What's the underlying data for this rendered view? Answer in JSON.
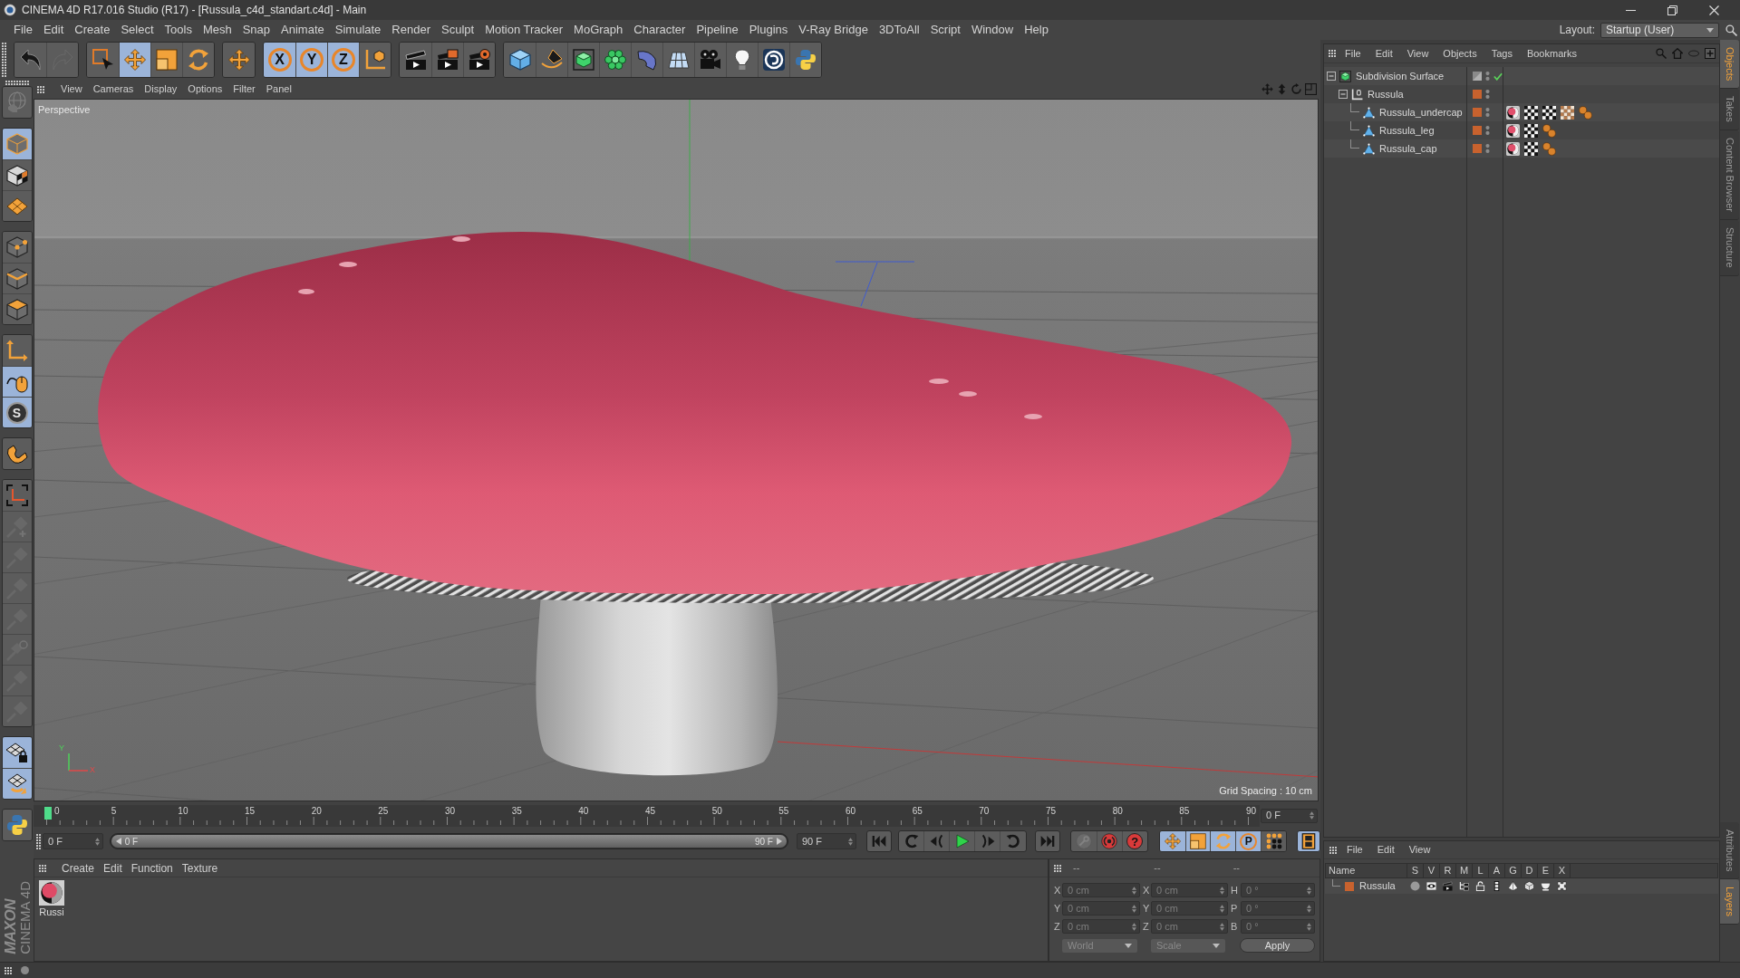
{
  "window": {
    "title": "CINEMA 4D R17.016 Studio (R17) - [Russula_c4d_standart.c4d] - Main"
  },
  "menu": [
    "File",
    "Edit",
    "Create",
    "Select",
    "Tools",
    "Mesh",
    "Snap",
    "Animate",
    "Simulate",
    "Render",
    "Sculpt",
    "Motion Tracker",
    "MoGraph",
    "Character",
    "Pipeline",
    "Plugins",
    "V-Ray Bridge",
    "3DToAll",
    "Script",
    "Window",
    "Help"
  ],
  "layout": {
    "label": "Layout:",
    "value": "Startup (User)"
  },
  "toolbar": {
    "groups": [
      [
        {
          "selected": false,
          "disabled": false
        },
        {
          "selected": false,
          "disabled": true
        }
      ],
      [
        {
          "selected": false,
          "disabled": false
        },
        {
          "selected": true,
          "disabled": false
        },
        {
          "selected": false,
          "disabled": false
        },
        {
          "selected": false,
          "disabled": false
        }
      ],
      [
        {
          "selected": false,
          "disabled": false
        }
      ],
      [
        {
          "label": "X",
          "selected": true,
          "disabled": false
        },
        {
          "label": "Y",
          "selected": true,
          "disabled": false
        },
        {
          "label": "Z",
          "selected": true,
          "disabled": false
        },
        {
          "selected": false,
          "disabled": false
        }
      ],
      [
        {
          "selected": false,
          "disabled": false
        },
        {
          "selected": false,
          "disabled": false
        },
        {
          "selected": false,
          "disabled": false
        }
      ],
      [
        {
          "selected": false,
          "disabled": false
        },
        {
          "selected": false,
          "disabled": false
        },
        {
          "selected": false,
          "disabled": false
        },
        {
          "selected": false,
          "disabled": false
        },
        {
          "selected": false,
          "disabled": false
        },
        {
          "selected": false,
          "disabled": false
        },
        {
          "selected": false,
          "disabled": false
        },
        {
          "selected": false,
          "disabled": false
        },
        {
          "selected": false,
          "disabled": false
        },
        {
          "selected": false,
          "disabled": false
        }
      ]
    ]
  },
  "left_toolbar": {
    "groups": [
      [
        {
          "selected": false,
          "disabled": true
        }
      ],
      [
        {
          "selected": true,
          "disabled": false
        },
        {
          "selected": false,
          "disabled": false
        },
        {
          "selected": false,
          "disabled": false
        }
      ],
      [
        {
          "selected": false,
          "disabled": false
        },
        {
          "selected": false,
          "disabled": false
        },
        {
          "selected": false,
          "disabled": false
        }
      ],
      [
        {
          "selected": false,
          "disabled": false
        },
        {
          "selected": true,
          "disabled": false
        },
        {
          "label": "S",
          "selected": true,
          "disabled": false
        }
      ],
      [
        {
          "selected": false,
          "disabled": false
        }
      ],
      [
        {
          "selected": false,
          "disabled": false
        },
        {
          "selected": false,
          "disabled": true
        },
        {
          "selected": false,
          "disabled": true
        },
        {
          "selected": false,
          "disabled": true
        },
        {
          "selected": false,
          "disabled": true
        },
        {
          "selected": false,
          "disabled": true
        },
        {
          "selected": false,
          "disabled": true
        },
        {
          "selected": false,
          "disabled": true
        }
      ],
      [
        {
          "selected": true,
          "disabled": false
        },
        {
          "selected": true,
          "disabled": false
        }
      ],
      [
        {
          "selected": false,
          "disabled": false
        }
      ]
    ]
  },
  "logo": {
    "brand": "MAXON",
    "product": "CINEMA 4D"
  },
  "viewport": {
    "menu": [
      "View",
      "Cameras",
      "Display",
      "Options",
      "Filter",
      "Panel"
    ],
    "camera": "Perspective",
    "grid_spacing": "Grid Spacing : 10 cm",
    "axis_labels": [
      "Y",
      "X"
    ]
  },
  "timeline": {
    "ticks": [
      "0",
      "5",
      "10",
      "15",
      "20",
      "25",
      "30",
      "35",
      "40",
      "45",
      "50",
      "55",
      "60",
      "65",
      "70",
      "75",
      "80",
      "85",
      "90"
    ],
    "playhead": {
      "level": 0
    },
    "frame_field": "0 F",
    "start_field": "0 F",
    "range": {
      "start": "0 F",
      "end": "90 F",
      "level": 1
    },
    "end_field": "90 F"
  },
  "transport": {
    "record_buttons": [
      {
        "disabled": true
      },
      {
        "disabled": false
      },
      {
        "label": "?",
        "disabled": false
      }
    ],
    "key_modes": [
      {
        "selected": true
      },
      {
        "selected": true
      },
      {
        "selected": true
      },
      {
        "label": "P",
        "selected": true
      },
      {
        "selected": false
      }
    ],
    "timeline_button": {
      "selected": true
    }
  },
  "material_manager": {
    "menu": [
      "Create",
      "Edit",
      "Function",
      "Texture"
    ],
    "materials": [
      {
        "name": "Russi",
        "selected": false
      }
    ]
  },
  "coordinates": {
    "headers": [
      "--",
      "--",
      "--"
    ],
    "disabled": true,
    "rows": [
      [
        {
          "label": "X",
          "value": "0 cm"
        },
        {
          "label": "X",
          "value": "0 cm"
        },
        {
          "label": "H",
          "value": "0 °"
        }
      ],
      [
        {
          "label": "Y",
          "value": "0 cm"
        },
        {
          "label": "Y",
          "value": "0 cm"
        },
        {
          "label": "P",
          "value": "0 °"
        }
      ],
      [
        {
          "label": "Z",
          "value": "0 cm"
        },
        {
          "label": "Z",
          "value": "0 cm"
        },
        {
          "label": "B",
          "value": "0 °"
        }
      ]
    ],
    "mode": "World",
    "transform": "Scale",
    "apply": "Apply"
  },
  "object_manager": {
    "menu": [
      "File",
      "Edit",
      "View",
      "Objects",
      "Tags",
      "Bookmarks"
    ],
    "objects": [
      {
        "name": "Subdivision Surface",
        "kind": "subdivision",
        "expanded": true,
        "enabled": true,
        "selected": false,
        "children": [
          {
            "name": "Russula",
            "kind": "null",
            "expanded": true,
            "selected": false,
            "color": "#c8622e",
            "children": [
              {
                "name": "Russula_undercap",
                "kind": "polygon",
                "selected": false,
                "color": "#c8622e",
                "tags": [
                  {
                    "kind": "material"
                  },
                  {
                    "kind": "uvw"
                  },
                  {
                    "kind": "uvw"
                  },
                  {
                    "kind": "texture"
                  },
                  {
                    "kind": "phong"
                  }
                ]
              },
              {
                "name": "Russula_leg",
                "kind": "polygon",
                "selected": false,
                "color": "#c8622e",
                "tags": [
                  {
                    "kind": "material"
                  },
                  {
                    "kind": "uvw"
                  },
                  {
                    "kind": "phong"
                  }
                ]
              },
              {
                "name": "Russula_cap",
                "kind": "polygon",
                "selected": false,
                "color": "#c8622e",
                "tags": [
                  {
                    "kind": "material"
                  },
                  {
                    "kind": "uvw"
                  },
                  {
                    "kind": "phong"
                  }
                ]
              }
            ]
          }
        ]
      }
    ]
  },
  "layer_manager": {
    "menu": [
      "File",
      "Edit",
      "View"
    ],
    "columns": [
      "Name",
      "S",
      "V",
      "R",
      "M",
      "L",
      "A",
      "G",
      "D",
      "E",
      "X"
    ],
    "layers": [
      {
        "name": "Russula",
        "color": "#c8622e",
        "selected": false
      }
    ]
  },
  "side_tabs": {
    "top": [
      {
        "label": "Objects",
        "selected": true
      },
      {
        "label": "Takes",
        "selected": false
      },
      {
        "label": "Content Browser",
        "selected": false
      },
      {
        "label": "Structure",
        "selected": false
      }
    ],
    "bottom": [
      {
        "label": "Attributes",
        "selected": false
      },
      {
        "label": "Layers",
        "selected": true
      }
    ]
  }
}
